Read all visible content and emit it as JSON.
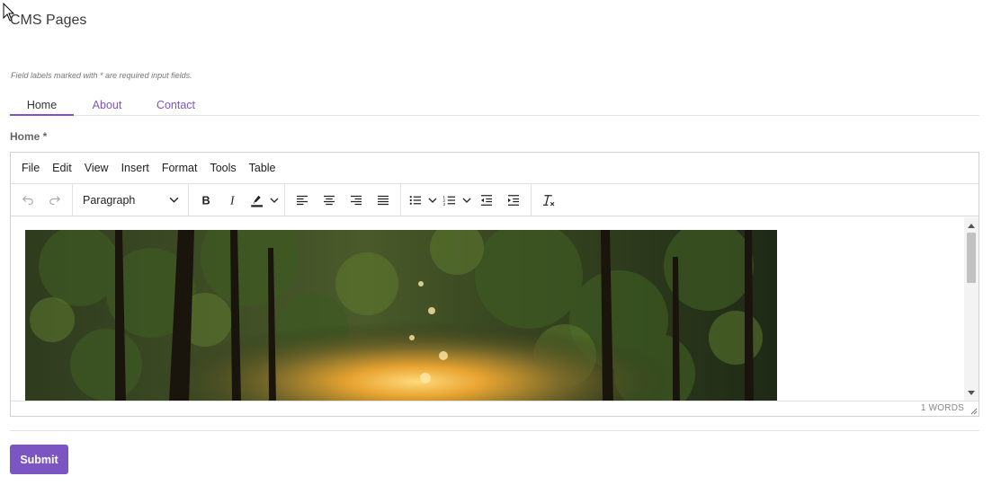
{
  "page": {
    "title": "CMS Pages",
    "hint": "Field labels marked with * are required input fields."
  },
  "tabs": [
    {
      "label": "Home",
      "active": true
    },
    {
      "label": "About",
      "active": false
    },
    {
      "label": "Contact",
      "active": false
    }
  ],
  "field": {
    "label": "Home *"
  },
  "editor": {
    "menubar": [
      "File",
      "Edit",
      "View",
      "Insert",
      "Format",
      "Tools",
      "Table"
    ],
    "block_format": "Paragraph",
    "word_count": "1 WORDS",
    "toolbar_icons": [
      "undo-icon",
      "redo-icon",
      "bold-icon",
      "italic-icon",
      "highlight-icon",
      "align-left-icon",
      "align-center-icon",
      "align-right-icon",
      "justify-icon",
      "bullet-list-icon",
      "numbered-list-icon",
      "outdent-icon",
      "indent-icon",
      "clear-formatting-icon"
    ]
  },
  "form": {
    "submit_label": "Submit"
  },
  "colors": {
    "accent": "#7b55c2"
  }
}
